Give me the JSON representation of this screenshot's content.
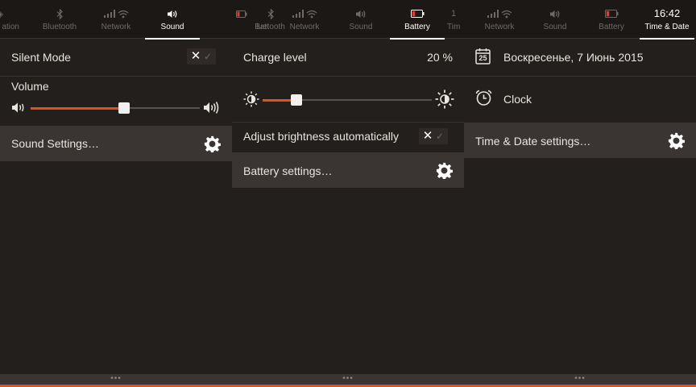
{
  "panels": {
    "sound": {
      "tabs": [
        {
          "label": "ation"
        },
        {
          "label": "Bluetooth"
        },
        {
          "label": "Network"
        },
        {
          "label": "Sound"
        }
      ],
      "silent_mode_label": "Silent Mode",
      "volume_label": "Volume",
      "volume_level": 0.55,
      "settings_label": "Sound Settings…"
    },
    "battery": {
      "tabs": [
        {
          "label": "Batt"
        },
        {
          "label": "luetooth"
        },
        {
          "label": "Network"
        },
        {
          "label": "Sound"
        },
        {
          "label": "Battery"
        },
        {
          "label": "Tim"
        }
      ],
      "charge_label": "Charge level",
      "charge_value": "20 %",
      "brightness_level": 0.2,
      "auto_brightness_label": "Adjust brightness automatically",
      "settings_label": "Battery settings…"
    },
    "datetime": {
      "tabs": [
        {
          "label": "Network"
        },
        {
          "label": "Sound"
        },
        {
          "label": "Battery"
        },
        {
          "label": "Time & Date"
        }
      ],
      "clock_time": "16:42",
      "date_label": "Воскресенье,  7 Июнь 2015",
      "calendar_day": "25",
      "clock_label": "Clock",
      "settings_label": "Time & Date settings…"
    }
  },
  "bottom_handle": "•••",
  "colors": {
    "accent": "#e2501d",
    "background": "#231f1c",
    "highlight": "#3a3533",
    "battery_low": "#e23b2e"
  }
}
